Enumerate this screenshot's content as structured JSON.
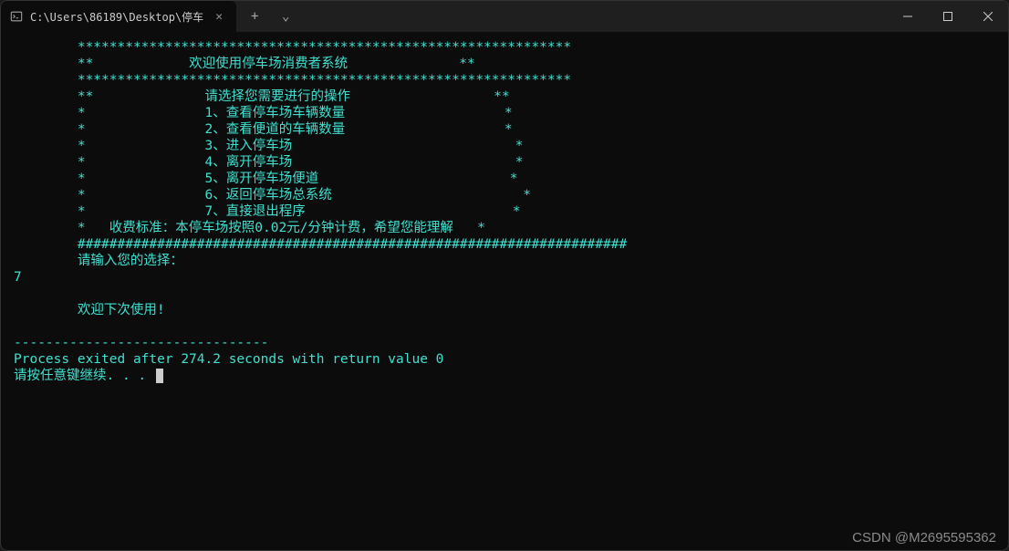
{
  "window": {
    "tab_title": "C:\\Users\\86189\\Desktop\\停车",
    "new_tab_label": "+",
    "dropdown_label": "⌄",
    "minimize_label": "─",
    "maximize_label": "☐",
    "close_label": "✕"
  },
  "terminal": {
    "border_top": "**************************************************************",
    "title_line_prefix": "**",
    "title_text": "欢迎使用停车场消费者系统",
    "title_line_suffix": "**",
    "border_top2": "**************************************************************",
    "menu_header_prefix": "**",
    "menu_header_text": "请选择您需要进行的操作",
    "menu_header_suffix": "**",
    "menu": [
      {
        "prefix": "*",
        "text": "1、查看停车场车辆数量",
        "suffix": "*"
      },
      {
        "prefix": "*",
        "text": "2、查看便道的车辆数量",
        "suffix": "*"
      },
      {
        "prefix": "*",
        "text": "3、进入停车场",
        "suffix": "*"
      },
      {
        "prefix": "*",
        "text": "4、离开停车场",
        "suffix": "*"
      },
      {
        "prefix": "*",
        "text": "5、离开停车场便道",
        "suffix": "*"
      },
      {
        "prefix": "*",
        "text": "6、返回停车场总系统",
        "suffix": "*"
      },
      {
        "prefix": "*",
        "text": "7、直接退出程序",
        "suffix": "*"
      }
    ],
    "fee_prefix": "*",
    "fee_text": "收费标准：本停车场按照0.02元/分钟计费，希望您能理解",
    "fee_suffix": "*",
    "border_bottom": "#####################################################################",
    "prompt": "请输入您的选择：",
    "user_input": "7",
    "goodbye": "欢迎下次使用!",
    "separator": "--------------------------------",
    "exit_msg": "Process exited after 274.2 seconds with return value 0",
    "continue_msg": "请按任意键继续. . . "
  },
  "watermark": "CSDN @M2695595362"
}
